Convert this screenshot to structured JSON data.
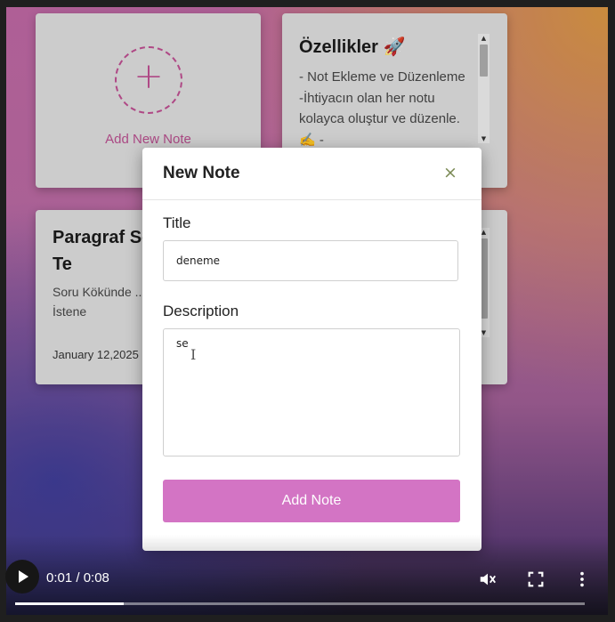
{
  "cards": {
    "add_card_label": "Add New Note",
    "feature_card": {
      "title": "Özellikler 🚀",
      "text": "- Not Ekleme ve Düzenleme -İhtiyacın olan her notu kolayca oluştur ve düzenle. ✍️ -"
    },
    "paragraph_card": {
      "title": "Paragraf Soru Çözme Te",
      "text": "Soru Kökünde ... Şıklara Göz Sizden İstene",
      "date": "January 12,2025"
    }
  },
  "modal": {
    "title": "New Note",
    "close_symbol": "×",
    "title_label": "Title",
    "title_value": "deneme",
    "description_label": "Description",
    "description_value": "se",
    "submit_label": "Add Note"
  },
  "video": {
    "current_time": "0:01",
    "duration": "0:08",
    "time_display": "0:01 / 0:08",
    "progress": 0.19,
    "icons": [
      "play-icon",
      "muted-volume-icon",
      "fullscreen-icon",
      "more-vert-icon"
    ]
  },
  "colors": {
    "accent": "#d374c4",
    "close": "#7b8a55",
    "plus": "#b94c8d"
  }
}
